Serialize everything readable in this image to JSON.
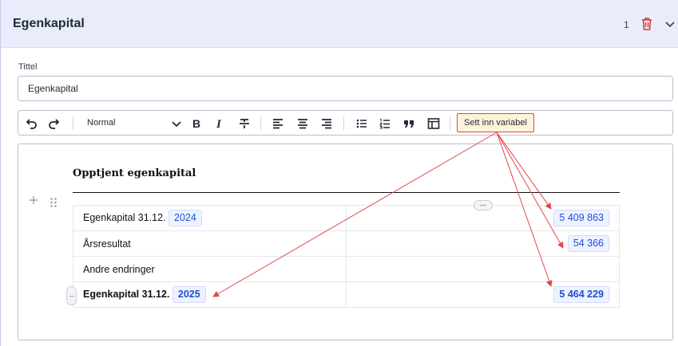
{
  "panel": {
    "title": "Egenkapital",
    "count": "1"
  },
  "form": {
    "title_label": "Tittel",
    "title_value": "Egenkapital"
  },
  "toolbar": {
    "text_style": "Normal",
    "insert_variable_label": "Sett inn variabel"
  },
  "document": {
    "heading": "Opptjent egenkapital",
    "rows": [
      {
        "label": "Egenkapital 31.12.",
        "label_variable": "2024",
        "value": "5 409 863"
      },
      {
        "label": "Årsresultat",
        "label_variable": "",
        "value": "54 366"
      },
      {
        "label": "Andre endringer",
        "label_variable": "",
        "value": ""
      },
      {
        "label": "Egenkapital 31.12.",
        "label_variable": "2025",
        "value": "5 464 229"
      }
    ]
  },
  "colors": {
    "header_bg": "#e9ecfb",
    "variable_chip_text": "#1d4ed8",
    "annotation_red": "#e04848",
    "insert_variable_bg": "#fbf4d8"
  },
  "icons": [
    "trash-icon",
    "chevron-down-icon",
    "undo-icon",
    "redo-icon",
    "bold-icon",
    "italic-icon",
    "strikethrough-icon",
    "align-left-icon",
    "align-center-icon",
    "align-right-icon",
    "bullet-list-icon",
    "numbered-list-icon",
    "blockquote-icon",
    "table-icon",
    "plus-icon",
    "drag-handle-icon"
  ]
}
